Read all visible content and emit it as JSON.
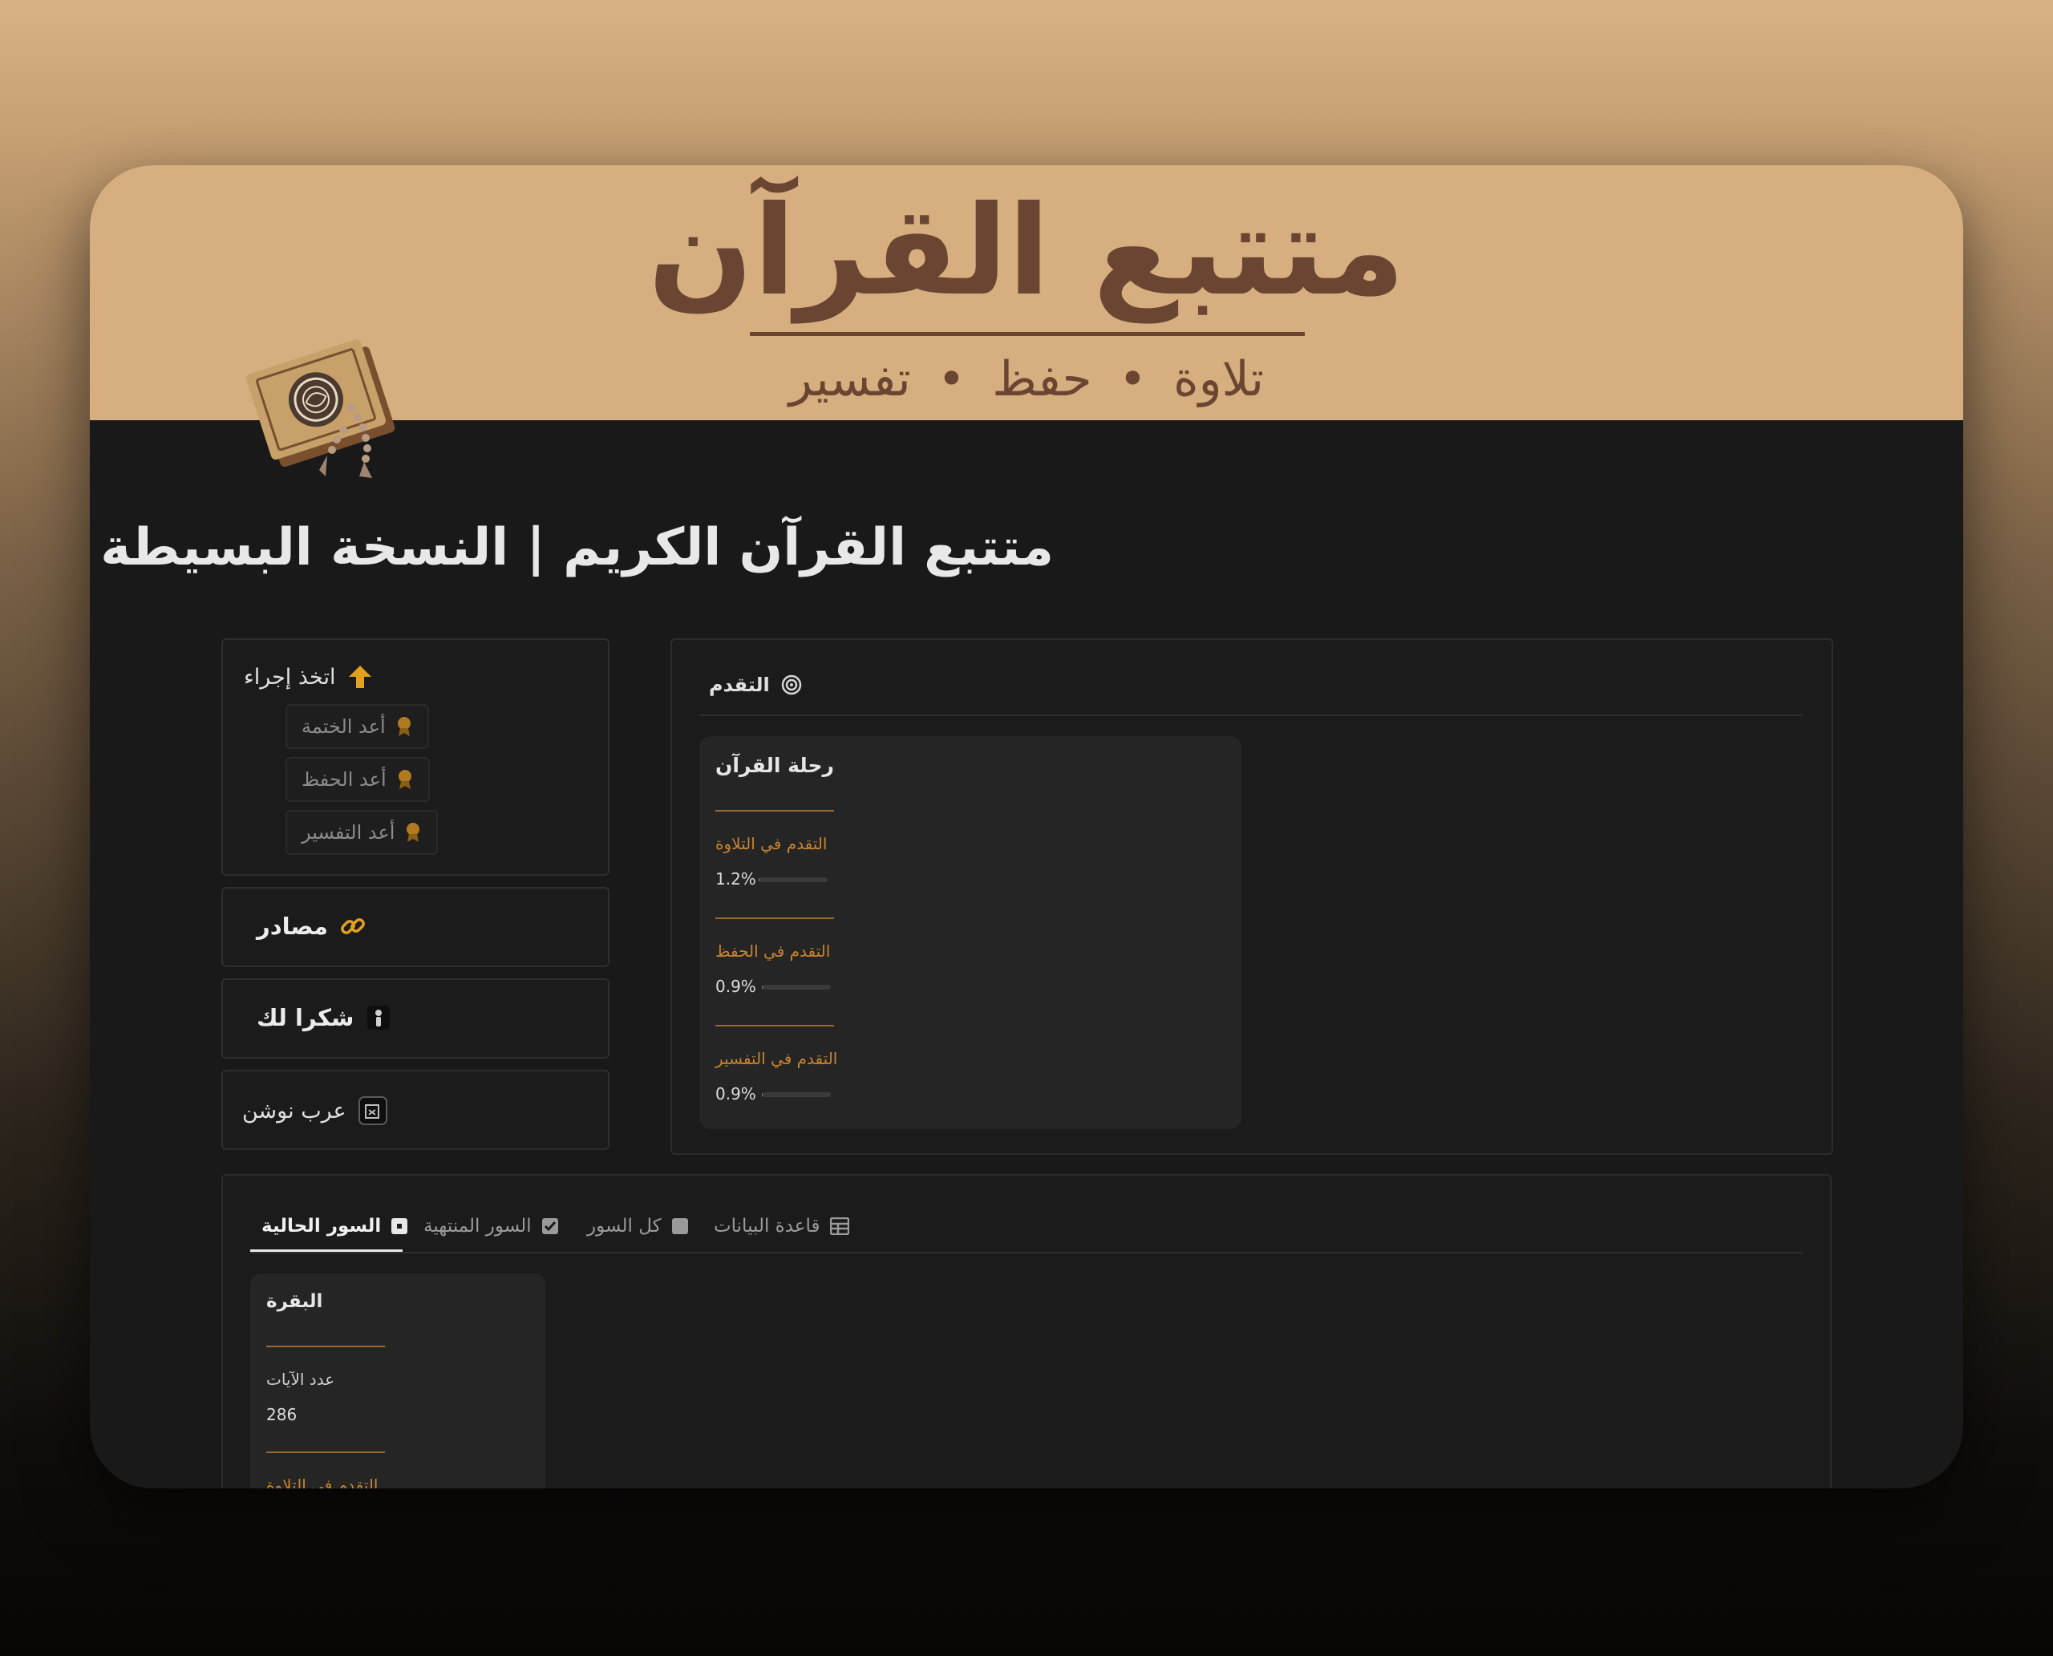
{
  "banner": {
    "title": "متتبع القرآن",
    "subtitle": "تلاوة  •  حفظ  •  تفسير"
  },
  "page": {
    "title": "متتبع القرآن الكريم | النسخة البسيطة",
    "icon": "quran-book-icon"
  },
  "sidebar": {
    "take_action": {
      "label": "اتخذ إجراء",
      "icon": "arrow-up-icon",
      "buttons": [
        {
          "label": "أعد الختمة",
          "icon": "award-icon"
        },
        {
          "label": "أعد الحفظ",
          "icon": "award-icon"
        },
        {
          "label": "أعد التفسير",
          "icon": "award-icon"
        }
      ]
    },
    "sources": {
      "label": "مصادر",
      "icon": "link-icon"
    },
    "thanks": {
      "label": "شكرا لك",
      "icon": "thanks-icon"
    },
    "arab_notion": {
      "label": "عرب نوشن",
      "icon": "arab-notion-logo-icon"
    }
  },
  "progress": {
    "heading": "التقدم",
    "heading_icon": "target-icon",
    "card": {
      "title": "رحلة القرآن",
      "items": [
        {
          "label": "التقدم في التلاوة",
          "value": "1.2%",
          "fraction": 0.012
        },
        {
          "label": "التقدم في الحفظ",
          "value": "0.9%",
          "fraction": 0.009
        },
        {
          "label": "التقدم في التفسير",
          "value": "0.9%",
          "fraction": 0.009
        }
      ]
    }
  },
  "surahs": {
    "tabs": [
      {
        "label": "السور الحالية",
        "icon": "square-dot-icon",
        "active": true
      },
      {
        "label": "السور المنتهية",
        "icon": "checkbox-icon",
        "active": false
      },
      {
        "label": "كل السور",
        "icon": "square-icon",
        "active": false
      },
      {
        "label": "قاعدة البيانات",
        "icon": "table-icon",
        "active": false
      }
    ],
    "cards": [
      {
        "title": "البقرة",
        "verse_count_label": "عدد الآيات",
        "verse_count": "286",
        "next_label": "التقدم في التلاوة"
      }
    ]
  },
  "colors": {
    "banner_bg": "#d6ae80",
    "banner_text": "#6a4632",
    "page_bg": "#191919",
    "accent": "#c8842e",
    "icon_gold": "#e0a020"
  }
}
